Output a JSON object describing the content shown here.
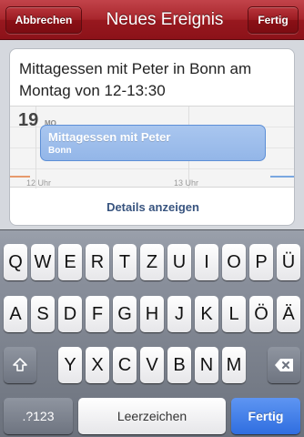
{
  "navbar": {
    "cancel_label": "Abbrechen",
    "title": "Neues Ereignis",
    "done_label": "Fertig"
  },
  "event_input": {
    "text": "Mittagessen mit Peter in Bonn am Montag von 12-13:30"
  },
  "calendar_preview": {
    "day_number": "19",
    "day_abbr": "MO",
    "event_title": "Mittagessen mit Peter",
    "event_location": "Bonn",
    "time_labels": [
      "12 Uhr",
      "13 Uhr"
    ]
  },
  "details_label": "Details anzeigen",
  "keyboard": {
    "row1": [
      "Q",
      "W",
      "E",
      "R",
      "T",
      "Z",
      "U",
      "I",
      "O",
      "P",
      "Ü"
    ],
    "row2": [
      "A",
      "S",
      "D",
      "F",
      "G",
      "H",
      "J",
      "K",
      "L",
      "Ö",
      "Ä"
    ],
    "row3": [
      "Y",
      "X",
      "C",
      "V",
      "B",
      "N",
      "M"
    ],
    "numbers_label": ".?123",
    "space_label": "Leerzeichen",
    "return_label": "Fertig",
    "shift_icon": "shift-icon",
    "backspace_icon": "backspace-icon"
  },
  "colors": {
    "navbar": "#a8262c",
    "event_block": "#93b6e8",
    "link": "#38547f",
    "return_key": "#2f6ee0"
  }
}
